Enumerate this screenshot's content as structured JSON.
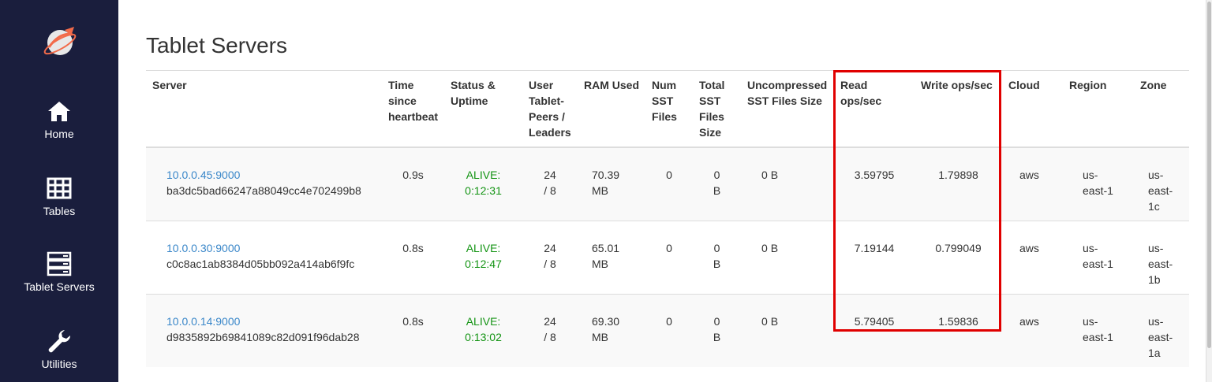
{
  "sidebar": {
    "items": [
      {
        "label": "Home",
        "icon": "home-icon"
      },
      {
        "label": "Tables",
        "icon": "table-icon"
      },
      {
        "label": "Tablet Servers",
        "icon": "server-icon"
      },
      {
        "label": "Utilities",
        "icon": "wrench-icon"
      }
    ],
    "logo": "rocket-planet-logo"
  },
  "page": {
    "title": "Tablet Servers"
  },
  "table": {
    "headers": {
      "server": "Server",
      "heartbeat": "Time since heartbeat",
      "status": "Status & Uptime",
      "peers": "User Tablet-Peers / Leaders",
      "ram": "RAM Used",
      "sst_files": "Num SST Files",
      "sst_size": "Total SST Files Size",
      "uncompressed": "Uncompressed SST Files Size",
      "read_ops": "Read ops/sec",
      "write_ops": "Write ops/sec",
      "cloud": "Cloud",
      "region": "Region",
      "zone": "Zone"
    },
    "rows": [
      {
        "address": "10.0.0.45:9000",
        "uuid": "ba3dc5bad66247a88049cc4e702499b8",
        "heartbeat": "0.9s",
        "status": "ALIVE:",
        "uptime": "0:12:31",
        "peers": "24",
        "leaders": "/ 8",
        "ram_value": "70.39",
        "ram_unit": "MB",
        "sst_files": "0",
        "sst_size_value": "0",
        "sst_size_unit": "B",
        "uncompressed": "0 B",
        "read_ops": "3.59795",
        "write_ops": "1.79898",
        "cloud": "aws",
        "region_a": "us-",
        "region_b": "east-1",
        "zone_a": "us-",
        "zone_b": "east-1c"
      },
      {
        "address": "10.0.0.30:9000",
        "uuid": "c0c8ac1ab8384d05bb092a414ab6f9fc",
        "heartbeat": "0.8s",
        "status": "ALIVE:",
        "uptime": "0:12:47",
        "peers": "24",
        "leaders": "/ 8",
        "ram_value": "65.01",
        "ram_unit": "MB",
        "sst_files": "0",
        "sst_size_value": "0",
        "sst_size_unit": "B",
        "uncompressed": "0 B",
        "read_ops": "7.19144",
        "write_ops": "0.799049",
        "cloud": "aws",
        "region_a": "us-",
        "region_b": "east-1",
        "zone_a": "us-",
        "zone_b": "east-1b"
      },
      {
        "address": "10.0.0.14:9000",
        "uuid": "d9835892b69841089c82d091f96dab28",
        "heartbeat": "0.8s",
        "status": "ALIVE:",
        "uptime": "0:13:02",
        "peers": "24",
        "leaders": "/ 8",
        "ram_value": "69.30",
        "ram_unit": "MB",
        "sst_files": "0",
        "sst_size_value": "0",
        "sst_size_unit": "B",
        "uncompressed": "0 B",
        "read_ops": "5.79405",
        "write_ops": "1.59836",
        "cloud": "aws",
        "region_a": "us-",
        "region_b": "east-1",
        "zone_a": "us-",
        "zone_b": "east-1a"
      }
    ]
  },
  "colors": {
    "sidebar_bg": "#1a1e3d",
    "link": "#3a87c9",
    "alive": "#149414",
    "highlight": "#e00000"
  }
}
